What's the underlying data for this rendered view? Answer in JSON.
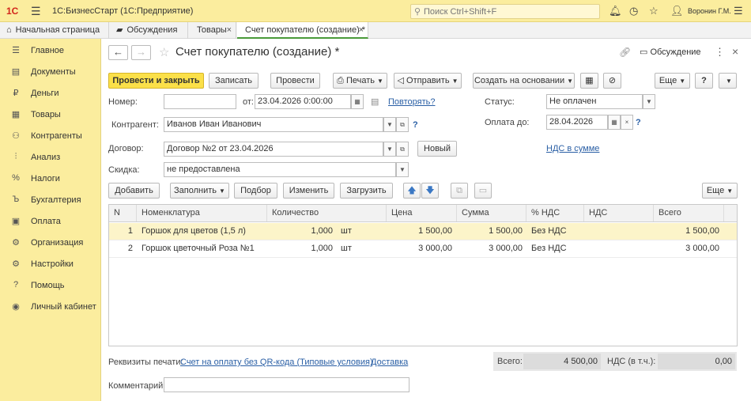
{
  "app": {
    "logo": "1С",
    "title": "1С:БизнесСтарт  (1С:Предприятие)",
    "search_placeholder": "Поиск Ctrl+Shift+F",
    "user": "Воронин Г.М."
  },
  "tabs": [
    {
      "label": "Начальная страница"
    },
    {
      "label": "Обсуждения"
    },
    {
      "label": "Товары"
    },
    {
      "label": "Счет покупателю (создание) *"
    }
  ],
  "sidebar": {
    "items": [
      {
        "label": "Главное",
        "icon": "menu-icon"
      },
      {
        "label": "Документы",
        "icon": "documents-icon"
      },
      {
        "label": "Деньги",
        "icon": "ruble-icon"
      },
      {
        "label": "Товары",
        "icon": "goods-icon"
      },
      {
        "label": "Контрагенты",
        "icon": "contractors-icon"
      },
      {
        "label": "Анализ",
        "icon": "analysis-icon"
      },
      {
        "label": "Налоги",
        "icon": "percent-icon"
      },
      {
        "label": "Бухгалтерия",
        "icon": "accounting-icon"
      },
      {
        "label": "Оплата",
        "icon": "payment-icon"
      },
      {
        "label": "Организация",
        "icon": "organization-icon"
      },
      {
        "label": "Настройки",
        "icon": "gear-icon"
      },
      {
        "label": "Помощь",
        "icon": "help-icon"
      },
      {
        "label": "Личный кабинет",
        "icon": "account-icon"
      }
    ]
  },
  "doc": {
    "title": "Счет покупателю (создание) *",
    "discuss": "Обсуждение"
  },
  "toolbar": {
    "post_close": "Провести и закрыть",
    "save": "Записать",
    "post": "Провести",
    "print": "Печать",
    "send": "Отправить",
    "create_based": "Создать на основании",
    "more": "Еще",
    "help": "?"
  },
  "form": {
    "number_label": "Номер:",
    "number_value": "",
    "date_label": "от:",
    "date_value": "23.04.2026  0:00:00",
    "repeat_link": "Повторять?",
    "status_label": "Статус:",
    "status_value": "Не оплачен",
    "contractor_label": "Контрагент:",
    "contractor_value": "Иванов Иван Иванович",
    "pay_until_label": "Оплата до:",
    "pay_until_value": "28.04.2026",
    "contract_label": "Договор:",
    "contract_value": "Договор №2 от 23.04.2026",
    "new_button": "Новый",
    "vat_link": "НДС в сумме",
    "discount_label": "Скидка:",
    "discount_value": "не предоставлена",
    "q": "?"
  },
  "table_toolbar": {
    "add": "Добавить",
    "fill": "Заполнить",
    "pick": "Подбор",
    "change": "Изменить",
    "load": "Загрузить",
    "more": "Еще"
  },
  "table": {
    "headers": [
      "N",
      "Номенклатура",
      "Количество",
      "Цена",
      "Сумма",
      "% НДС",
      "НДС",
      "Всего"
    ],
    "rows": [
      {
        "n": "1",
        "name": "Горшок для цветов (1,5 л)",
        "qty": "1,000",
        "unit": "шт",
        "price": "1 500,00",
        "sum": "1 500,00",
        "vat_rate": "Без НДС",
        "vat": "",
        "total": "1 500,00"
      },
      {
        "n": "2",
        "name": "Горшок цветочный Роза №1",
        "qty": "1,000",
        "unit": "шт",
        "price": "3 000,00",
        "sum": "3 000,00",
        "vat_rate": "Без НДС",
        "vat": "",
        "total": "3 000,00"
      }
    ]
  },
  "footer": {
    "print_label": "Реквизиты печати:",
    "print_link": "Счет на оплату без QR-кода (Типовые условия)",
    "delivery_link": "Доставка",
    "total_label": "Всего:",
    "total_value": "4 500,00",
    "vat_label": "НДС (в т.ч.):",
    "vat_value": "0,00",
    "comment_label": "Комментарий:",
    "comment_value": ""
  }
}
